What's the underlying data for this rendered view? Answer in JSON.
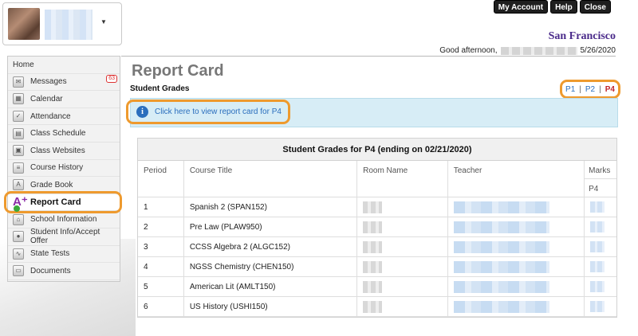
{
  "header": {
    "buttons": [
      "My Account",
      "Help",
      "Close"
    ],
    "school_name": "San Francisco",
    "greeting": "Good afternoon,",
    "date": "5/26/2020"
  },
  "sidebar": {
    "items": [
      {
        "label": "Home",
        "icon": "home-text"
      },
      {
        "label": "Messages",
        "icon": "messages-icon",
        "badge": "63"
      },
      {
        "label": "Calendar",
        "icon": "calendar-icon"
      },
      {
        "label": "Attendance",
        "icon": "attendance-icon"
      },
      {
        "label": "Class Schedule",
        "icon": "schedule-icon"
      },
      {
        "label": "Class Websites",
        "icon": "websites-icon"
      },
      {
        "label": "Course History",
        "icon": "course-history-icon"
      },
      {
        "label": "Grade Book",
        "icon": "gradebook-icon"
      },
      {
        "label": "Report Card",
        "icon": "report-card-icon"
      },
      {
        "label": "School Information",
        "icon": "school-info-icon"
      },
      {
        "label": "Student Info/Accept Offer",
        "icon": "student-info-icon"
      },
      {
        "label": "State Tests",
        "icon": "state-tests-icon"
      },
      {
        "label": "Documents",
        "icon": "documents-icon"
      }
    ]
  },
  "main": {
    "title": "Report Card",
    "section": "Student Grades",
    "periods": [
      "P1",
      "P2",
      "P4"
    ],
    "info_link": "Click here to view report card for P4",
    "table": {
      "title": "Student Grades for P4 (ending on 02/21/2020)",
      "columns": [
        "Period",
        "Course Title",
        "Room Name",
        "Teacher",
        "Marks"
      ],
      "marks_sub": "P4",
      "rows": [
        {
          "period": "1",
          "course": "Spanish 2 (SPAN152)"
        },
        {
          "period": "2",
          "course": "Pre Law (PLAW950)"
        },
        {
          "period": "3",
          "course": "CCSS Algebra 2 (ALGC152)"
        },
        {
          "period": "4",
          "course": "NGSS Chemistry (CHEN150)"
        },
        {
          "period": "5",
          "course": "American Lit (AMLT150)"
        },
        {
          "period": "6",
          "course": "US History (USHI150)"
        }
      ]
    }
  },
  "colors": {
    "accent_highlight": "#ee9a2e",
    "link": "#2a6ebd",
    "school_name": "#4a2a8a"
  }
}
